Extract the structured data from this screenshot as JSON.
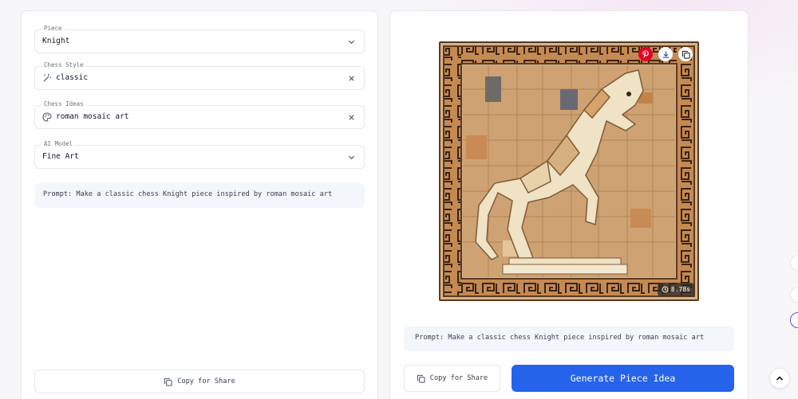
{
  "form": {
    "piece": {
      "label": "Piece",
      "value": "Knight"
    },
    "chess_style": {
      "label": "Chess Style",
      "value": "classic"
    },
    "chess_ideas": {
      "label": "Chess Ideas",
      "value": "roman mosaic art"
    },
    "ai_model": {
      "label": "AI Model",
      "value": "Fine Art"
    }
  },
  "prompt_text": "Prompt: Make a classic chess Knight piece inspired by roman mosaic art",
  "copy_share_label": "Copy for Share",
  "result": {
    "elapsed_time": "8.78s",
    "actions": [
      "pinterest-icon",
      "download-icon",
      "copy-icon"
    ]
  },
  "generate_label": "Generate Piece Idea",
  "colors": {
    "accent": "#2563eb",
    "pinterest": "#e60023",
    "panel_bg": "#ffffff",
    "prompt_bg": "#f3f6fb"
  }
}
